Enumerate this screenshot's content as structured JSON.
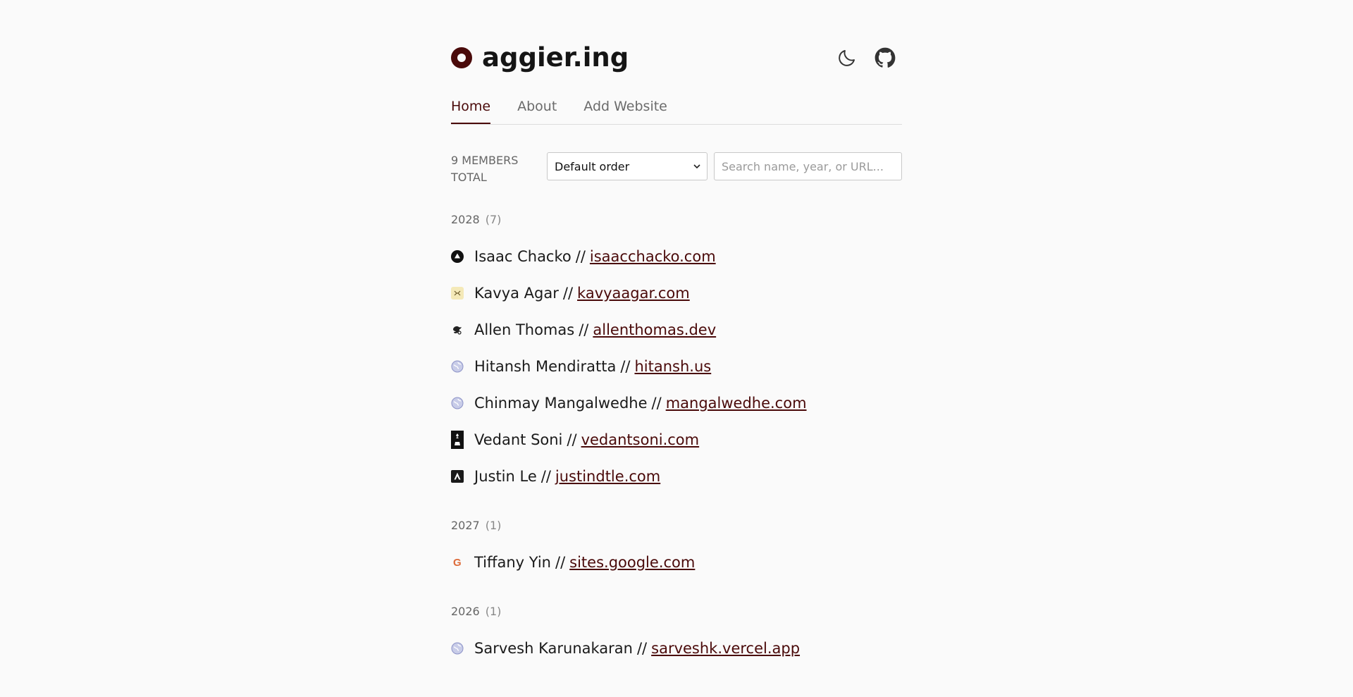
{
  "brand": {
    "name": "aggier.ing",
    "accent_color": "#4a0a0a"
  },
  "header_icons": [
    "moon-icon",
    "github-icon"
  ],
  "tabs": [
    {
      "label": "Home",
      "active": true
    },
    {
      "label": "About",
      "active": false
    },
    {
      "label": "Add Website",
      "active": false
    }
  ],
  "controls": {
    "members_total": "9 MEMBERS TOTAL",
    "sort_selected": "Default order",
    "search_placeholder": "Search name, year, or URL..."
  },
  "separator": "//",
  "groups": [
    {
      "year": "2028",
      "count": "(7)",
      "members": [
        {
          "name": "Isaac Chacko",
          "url": "isaacchacko.com",
          "icon": "triangle-circle-icon"
        },
        {
          "name": "Kavya Agar",
          "url": "kavyaagar.com",
          "icon": "kavya-logo-icon"
        },
        {
          "name": "Allen Thomas",
          "url": "allenthomas.dev",
          "icon": "bird-icon"
        },
        {
          "name": "Hitansh Mendiratta",
          "url": "hitansh.us",
          "icon": "globe-icon"
        },
        {
          "name": "Chinmay Mangalwedhe",
          "url": "mangalwedhe.com",
          "icon": "globe-icon"
        },
        {
          "name": "Vedant Soni",
          "url": "vedantsoni.com",
          "icon": "chess-piece-icon"
        },
        {
          "name": "Justin Le",
          "url": "justindtle.com",
          "icon": "letter-a-icon"
        }
      ]
    },
    {
      "year": "2027",
      "count": "(1)",
      "members": [
        {
          "name": "Tiffany Yin",
          "url": "sites.google.com",
          "icon": "google-icon"
        }
      ]
    },
    {
      "year": "2026",
      "count": "(1)",
      "members": [
        {
          "name": "Sarvesh Karunakaran",
          "url": "sarveshk.vercel.app",
          "icon": "globe-icon"
        }
      ]
    }
  ]
}
